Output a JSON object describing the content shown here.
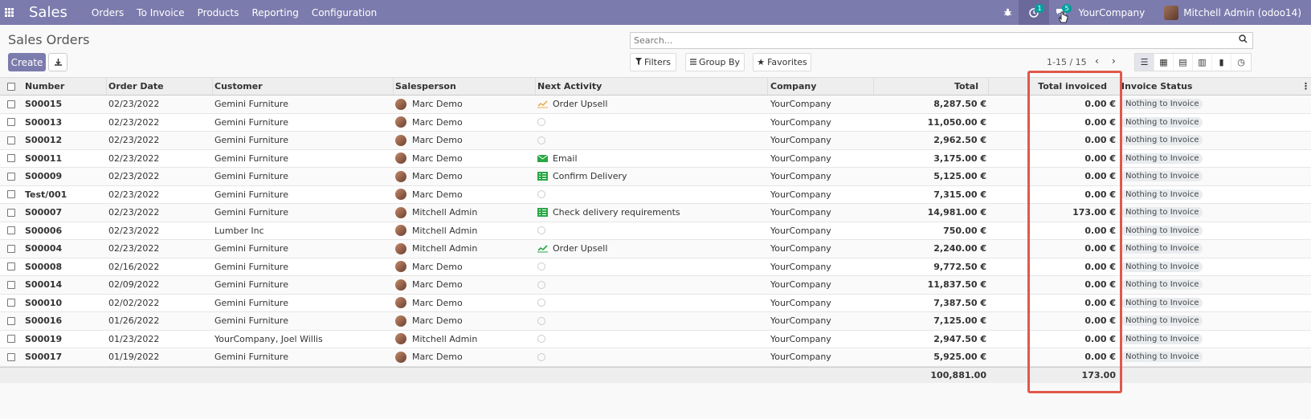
{
  "navbar": {
    "app_name": "Sales",
    "menu": [
      "Orders",
      "To Invoice",
      "Products",
      "Reporting",
      "Configuration"
    ],
    "activity_badge": "1",
    "messages_badge": "5",
    "company": "YourCompany",
    "user": "Mitchell Admin (odoo14)"
  },
  "control": {
    "title": "Sales Orders",
    "create_label": "Create",
    "search_placeholder": "Search...",
    "filters_label": "Filters",
    "groupby_label": "Group By",
    "favorites_label": "Favorites",
    "pager": "1-15 / 15"
  },
  "columns": {
    "number": "Number",
    "order_date": "Order Date",
    "customer": "Customer",
    "salesperson": "Salesperson",
    "next_activity": "Next Activity",
    "company": "Company",
    "total": "Total",
    "total_invoiced": "Total invoiced",
    "invoice_status": "Invoice Status"
  },
  "rows": [
    {
      "number": "S00015",
      "date": "02/23/2022",
      "customer": "Gemini Furniture",
      "salesperson": "Marc Demo",
      "activity": "Order Upsell",
      "activity_icon": "chart-icon",
      "activity_color": "#f0ad4e",
      "company": "YourCompany",
      "total": "8,287.50 €",
      "invoiced": "0.00 €",
      "status": "Nothing to Invoice"
    },
    {
      "number": "S00013",
      "date": "02/23/2022",
      "customer": "Gemini Furniture",
      "salesperson": "Marc Demo",
      "activity": "",
      "activity_icon": "clock-icon",
      "company": "YourCompany",
      "total": "11,050.00 €",
      "invoiced": "0.00 €",
      "status": "Nothing to Invoice"
    },
    {
      "number": "S00012",
      "date": "02/23/2022",
      "customer": "Gemini Furniture",
      "salesperson": "Marc Demo",
      "activity": "",
      "activity_icon": "clock-icon",
      "company": "YourCompany",
      "total": "2,962.50 €",
      "invoiced": "0.00 €",
      "status": "Nothing to Invoice"
    },
    {
      "number": "S00011",
      "date": "02/23/2022",
      "customer": "Gemini Furniture",
      "salesperson": "Marc Demo",
      "activity": "Email",
      "activity_icon": "email-icon",
      "activity_color": "#28a745",
      "company": "YourCompany",
      "total": "3,175.00 €",
      "invoiced": "0.00 €",
      "status": "Nothing to Invoice"
    },
    {
      "number": "S00009",
      "date": "02/23/2022",
      "customer": "Gemini Furniture",
      "salesperson": "Marc Demo",
      "activity": "Confirm Delivery",
      "activity_icon": "tasks-icon",
      "activity_color": "#28a745",
      "company": "YourCompany",
      "total": "5,125.00 €",
      "invoiced": "0.00 €",
      "status": "Nothing to Invoice"
    },
    {
      "number": "Test/001",
      "date": "02/23/2022",
      "customer": "Gemini Furniture",
      "salesperson": "Marc Demo",
      "activity": "",
      "activity_icon": "clock-icon",
      "company": "YourCompany",
      "total": "7,315.00 €",
      "invoiced": "0.00 €",
      "status": "Nothing to Invoice"
    },
    {
      "number": "S00007",
      "date": "02/23/2022",
      "customer": "Gemini Furniture",
      "salesperson": "Mitchell Admin",
      "activity": "Check delivery requirements",
      "activity_icon": "tasks-icon",
      "activity_color": "#28a745",
      "company": "YourCompany",
      "total": "14,981.00 €",
      "invoiced": "173.00 €",
      "status": "Nothing to Invoice"
    },
    {
      "number": "S00006",
      "date": "02/23/2022",
      "customer": "Lumber Inc",
      "salesperson": "Mitchell Admin",
      "activity": "",
      "activity_icon": "clock-icon",
      "company": "YourCompany",
      "total": "750.00 €",
      "invoiced": "0.00 €",
      "status": "Nothing to Invoice"
    },
    {
      "number": "S00004",
      "date": "02/23/2022",
      "customer": "Gemini Furniture",
      "salesperson": "Mitchell Admin",
      "activity": "Order Upsell",
      "activity_icon": "chart-icon",
      "activity_color": "#28a745",
      "company": "YourCompany",
      "total": "2,240.00 €",
      "invoiced": "0.00 €",
      "status": "Nothing to Invoice"
    },
    {
      "number": "S00008",
      "date": "02/16/2022",
      "customer": "Gemini Furniture",
      "salesperson": "Marc Demo",
      "activity": "",
      "activity_icon": "clock-icon",
      "company": "YourCompany",
      "total": "9,772.50 €",
      "invoiced": "0.00 €",
      "status": "Nothing to Invoice"
    },
    {
      "number": "S00014",
      "date": "02/09/2022",
      "customer": "Gemini Furniture",
      "salesperson": "Marc Demo",
      "activity": "",
      "activity_icon": "clock-icon",
      "company": "YourCompany",
      "total": "11,837.50 €",
      "invoiced": "0.00 €",
      "status": "Nothing to Invoice"
    },
    {
      "number": "S00010",
      "date": "02/02/2022",
      "customer": "Gemini Furniture",
      "salesperson": "Marc Demo",
      "activity": "",
      "activity_icon": "clock-icon",
      "company": "YourCompany",
      "total": "7,387.50 €",
      "invoiced": "0.00 €",
      "status": "Nothing to Invoice"
    },
    {
      "number": "S00016",
      "date": "01/26/2022",
      "customer": "Gemini Furniture",
      "salesperson": "Marc Demo",
      "activity": "",
      "activity_icon": "clock-icon",
      "company": "YourCompany",
      "total": "7,125.00 €",
      "invoiced": "0.00 €",
      "status": "Nothing to Invoice"
    },
    {
      "number": "S00019",
      "date": "01/23/2022",
      "customer": "YourCompany, Joel Willis",
      "salesperson": "Mitchell Admin",
      "activity": "",
      "activity_icon": "clock-icon",
      "company": "YourCompany",
      "total": "2,947.50 €",
      "invoiced": "0.00 €",
      "status": "Nothing to Invoice"
    },
    {
      "number": "S00017",
      "date": "01/19/2022",
      "customer": "Gemini Furniture",
      "salesperson": "Marc Demo",
      "activity": "",
      "activity_icon": "clock-icon",
      "company": "YourCompany",
      "total": "5,925.00 €",
      "invoiced": "0.00 €",
      "status": "Nothing to Invoice"
    }
  ],
  "footer": {
    "total_sum": "100,881.00",
    "invoiced_sum": "173.00"
  },
  "colors": {
    "navbar": "#7c7bad",
    "highlight": "#e0584a"
  }
}
